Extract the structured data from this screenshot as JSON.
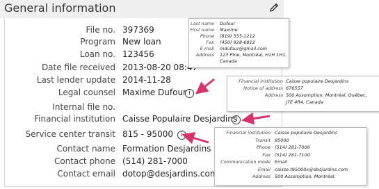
{
  "header": {
    "title": "General information",
    "edit_icon": "pencil-icon"
  },
  "fields": [
    {
      "label": "File no.",
      "value": "397369"
    },
    {
      "label": "Program",
      "value": "New loan"
    },
    {
      "label": "Loan no.",
      "value": "123456"
    },
    {
      "label": "Date file received",
      "value": "2013-08-20  08:47"
    },
    {
      "label": "Last lender update",
      "value": "2014-11-28"
    },
    {
      "label": "Legal counsel",
      "value": "Maxime Dufour"
    },
    {
      "label": "Internal file no.",
      "value": ""
    },
    {
      "label": "Financial institution",
      "value": "Caisse Populaire Desjardins"
    },
    {
      "label": "Service center transit",
      "value": "815 - 95000"
    },
    {
      "label": "Contact name",
      "value": "Formation Desjardins"
    },
    {
      "label": "Contact phone",
      "value": "(514) 281-7000"
    },
    {
      "label": "Contact email",
      "value": "dotop@desjardins.com"
    }
  ],
  "popups": {
    "counsel": [
      {
        "label": "Last name",
        "value": "Dufour"
      },
      {
        "label": "First name",
        "value": "Maxime"
      },
      {
        "label": "Phone",
        "value": "(819) 555-1212"
      },
      {
        "label": "Fax",
        "value": "(450) 928-6812"
      },
      {
        "label": "E-mail",
        "value": "mdufour@gmail.com"
      },
      {
        "label": "Address",
        "value": "123 Pine, Montréal, H1H 1H1,"
      },
      {
        "label": "",
        "value": "Canada"
      }
    ],
    "institution": [
      {
        "label": "Financial institution",
        "value": "Caisse populaire Desjardins"
      },
      {
        "label": "Notice of address",
        "value": "676557"
      },
      {
        "label": "Address",
        "value": "500 Assomption, Montréal, Québec,"
      },
      {
        "label": "",
        "value": "J7E 4R4, Canada"
      }
    ],
    "transit": [
      {
        "label": "Financial institution",
        "value": "Caisse populaire Desjardins"
      },
      {
        "label": "Transit",
        "value": "95000"
      },
      {
        "label": "Phone",
        "value": "(514) 281-7000"
      },
      {
        "label": "Fax",
        "value": "(514) 281-7100"
      },
      {
        "label": "Communication mode",
        "value": "Email"
      },
      {
        "label": "Email",
        "value": "caisse.t95000x@desjardins.com"
      },
      {
        "label": "Address",
        "value": "500 Assomption, Montréal,"
      }
    ]
  },
  "colors": {
    "arrow": "#d6336c"
  }
}
